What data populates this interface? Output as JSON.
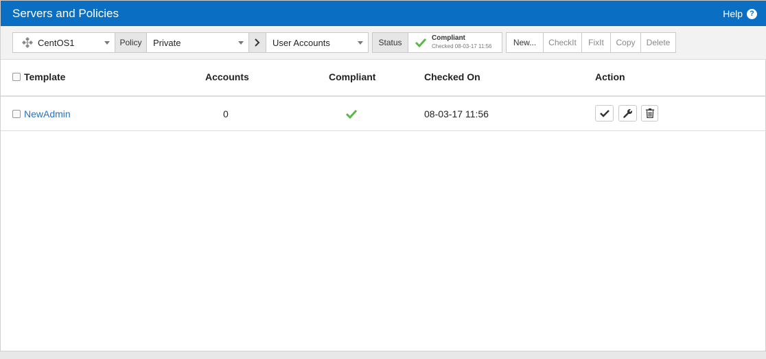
{
  "header": {
    "title": "Servers and Policies",
    "help_label": "Help",
    "help_icon": "?"
  },
  "toolbar": {
    "server": "CentOS1",
    "policy_label": "Policy",
    "policy_value": "Private",
    "category_value": "User Accounts",
    "status_label": "Status",
    "status_title": "Compliant",
    "status_sub": "Checked 08-03-17 11:56",
    "buttons": {
      "new": "New...",
      "checkit": "CheckIt",
      "fixit": "FixIt",
      "copy": "Copy",
      "delete": "Delete"
    }
  },
  "table": {
    "headers": {
      "template": "Template",
      "accounts": "Accounts",
      "compliant": "Compliant",
      "checked_on": "Checked On",
      "action": "Action"
    },
    "rows": [
      {
        "template": "NewAdmin",
        "accounts": "0",
        "compliant": true,
        "checked_on": "08-03-17 11:56"
      }
    ]
  },
  "colors": {
    "accent": "#0a6fc2",
    "success": "#5cb84a",
    "link": "#2a71b8"
  }
}
